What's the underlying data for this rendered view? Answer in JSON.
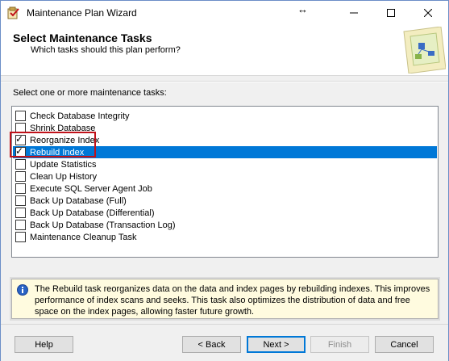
{
  "window": {
    "title": "Maintenance Plan Wizard",
    "cursor_glyph": "↔"
  },
  "header": {
    "title": "Select Maintenance Tasks",
    "subtitle": "Which tasks should this plan perform?"
  },
  "tasks_label": "Select one or more maintenance tasks:",
  "tasks": [
    {
      "label": "Check Database Integrity",
      "checked": false,
      "selected": false
    },
    {
      "label": "Shrink Database",
      "checked": false,
      "selected": false
    },
    {
      "label": "Reorganize Index",
      "checked": true,
      "selected": false
    },
    {
      "label": "Rebuild Index",
      "checked": true,
      "selected": true
    },
    {
      "label": "Update Statistics",
      "checked": false,
      "selected": false
    },
    {
      "label": "Clean Up History",
      "checked": false,
      "selected": false
    },
    {
      "label": "Execute SQL Server Agent Job",
      "checked": false,
      "selected": false
    },
    {
      "label": "Back Up Database (Full)",
      "checked": false,
      "selected": false
    },
    {
      "label": "Back Up Database (Differential)",
      "checked": false,
      "selected": false
    },
    {
      "label": "Back Up Database (Transaction Log)",
      "checked": false,
      "selected": false
    },
    {
      "label": "Maintenance Cleanup Task",
      "checked": false,
      "selected": false
    }
  ],
  "description": "The Rebuild task reorganizes data on the data and index pages by rebuilding indexes. This improves performance of index scans and seeks. This task also optimizes the distribution of data and free space on the index pages, allowing faster future growth.",
  "buttons": {
    "help": "Help",
    "back": "< Back",
    "next": "Next >",
    "finish": "Finish",
    "cancel": "Cancel"
  },
  "colors": {
    "selection": "#0078d7",
    "annotation": "#c0121a",
    "info_background": "#fffbdf"
  }
}
